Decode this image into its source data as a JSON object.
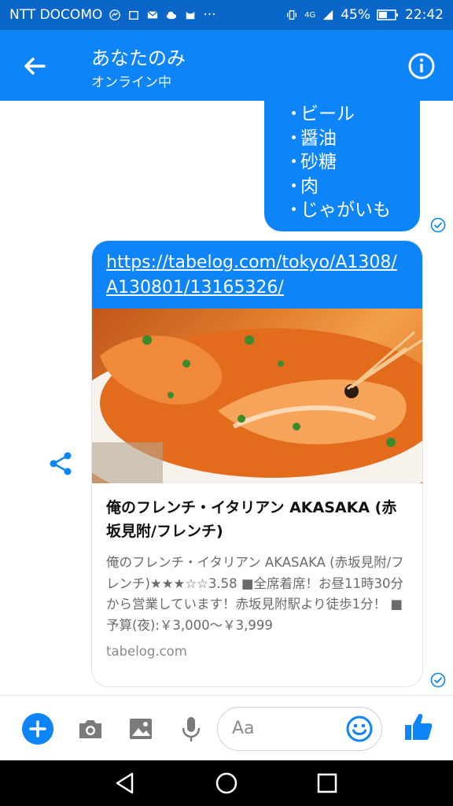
{
  "status_bar": {
    "carrier": "NTT DOCOMO",
    "network": "4G",
    "battery": "45%",
    "time": "22:42"
  },
  "header": {
    "title": "あなたのみ",
    "subtitle": "オンライン中"
  },
  "message1": {
    "items": [
      "ビール",
      "醤油",
      "砂糖",
      "肉",
      "じゃがいも"
    ],
    "bullet": "・"
  },
  "link_card": {
    "url": "https://tabelog.com/tokyo/A1308/A130801/13165326/",
    "title": "俺のフレンチ・イタリアン AKASAKA (赤坂見附/フレンチ)",
    "description": "俺のフレンチ・イタリアン AKASAKA (赤坂見附/フレンチ)★★★☆☆3.58 ■全席着席！お昼11時30分から営業しています！赤坂見附駅より徒歩1分！ ■予算(夜):￥3,000〜￥3,999",
    "domain": "tabelog.com"
  },
  "composer": {
    "placeholder": "Aa"
  },
  "colors": {
    "status_bar": "#0a67c9",
    "header": "#0d84f7",
    "bubble": "#0d84f7",
    "navbar": "#000000"
  }
}
